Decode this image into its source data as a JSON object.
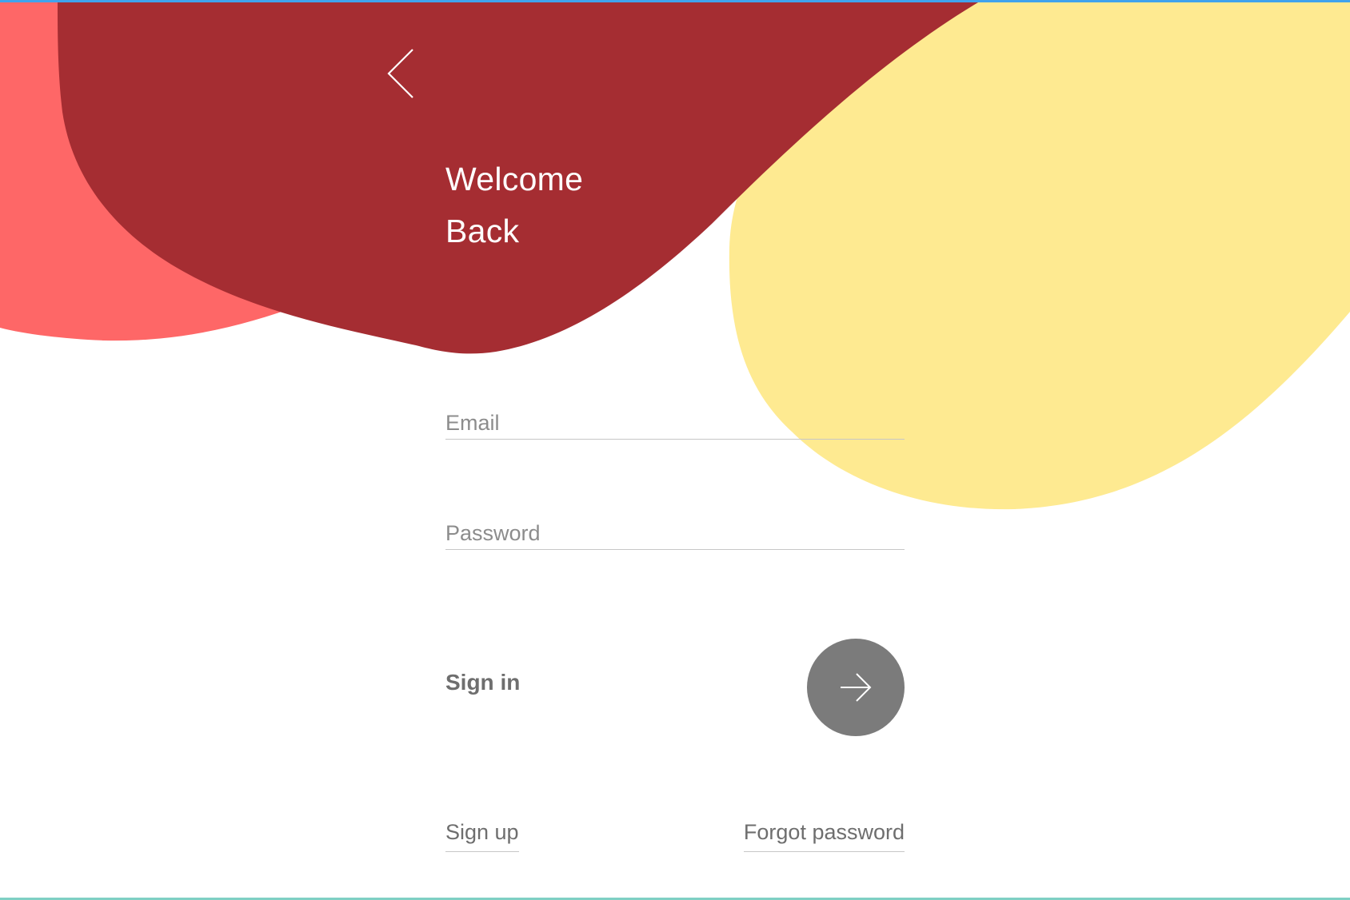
{
  "header": {
    "title_line1": "Welcome",
    "title_line2": "Back"
  },
  "form": {
    "email": {
      "placeholder": "Email",
      "value": ""
    },
    "password": {
      "placeholder": "Password",
      "value": ""
    }
  },
  "signin": {
    "label": "Sign in",
    "icon": "arrow-right-icon"
  },
  "links": {
    "signup": "Sign up",
    "forgot": "Forgot password"
  },
  "icons": {
    "back": "chevron-left-icon"
  },
  "colors": {
    "blob_coral": "#fe6767",
    "blob_dark_red": "#a52d32",
    "blob_yellow": "#fee98b",
    "signin_button": "#7b7b7b",
    "top_strip": "#3fa3ee",
    "bottom_strip": "#7fd0c4"
  }
}
